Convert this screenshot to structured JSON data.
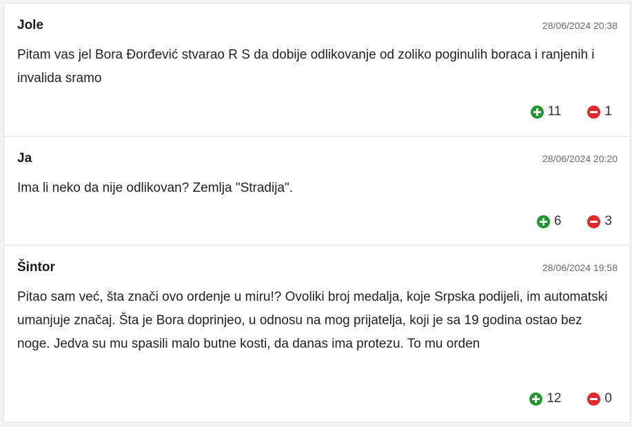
{
  "comments": [
    {
      "author": "Jole",
      "date": "28/06/2024 20:38",
      "text": "Pitam vas jel Bora Đorđević stvarao R S da dobije odlikovanje od zoliko poginulih boraca i ranjenih i invalida sramo",
      "likes": "11",
      "dislikes": "1"
    },
    {
      "author": "Ja",
      "date": "28/06/2024 20:20",
      "text": "Ima li neko da nije odlikovan? Zemlja \"Stradija\".",
      "likes": "6",
      "dislikes": "3"
    },
    {
      "author": "Šintor",
      "date": "28/06/2024 19:58",
      "text": "Pitao sam već, šta znači ovo ordenje u miru!? Ovoliki broj medalja, koje Srpska podijeli, im automatski umanjuje značaj. Šta je Bora doprinjeo, u odnosu na mog prijatelja, koji je sa 19 godina ostao bez noge. Jedva su mu spasili malo butne kosti, da danas ima protezu. To mu orden",
      "likes": "12",
      "dislikes": "0"
    }
  ],
  "icons": {
    "upvote": "plus-circle-icon",
    "downvote": "minus-circle-icon"
  },
  "colors": {
    "upvote": "#1f9a2e",
    "downvote": "#e02a2a"
  }
}
